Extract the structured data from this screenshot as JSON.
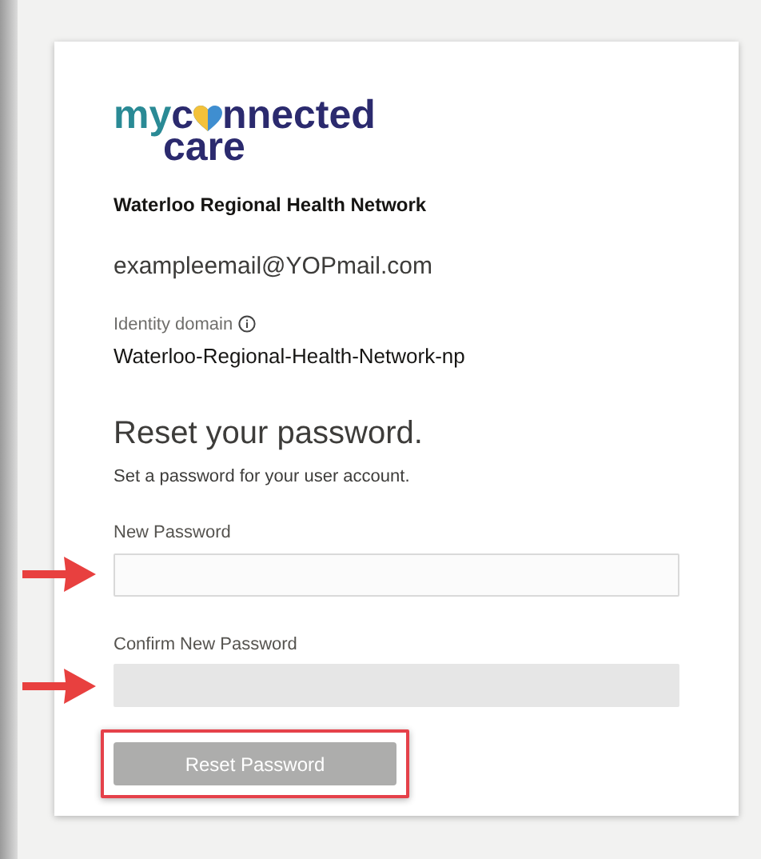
{
  "logo": {
    "prefix": "my",
    "word_start": "c",
    "word_end": "nnected",
    "second_line": "care"
  },
  "organization": "Waterloo Regional Health Network",
  "email": "exampleemail@YOPmail.com",
  "identity_domain": {
    "label": "Identity domain",
    "value": "Waterloo-Regional-Health-Network-np"
  },
  "heading": "Reset your password.",
  "subtitle": "Set a password for your user account.",
  "fields": [
    {
      "label": "New Password",
      "disabled": false,
      "arrow": true
    },
    {
      "label": "Confirm New Password",
      "disabled": true,
      "arrow": true
    }
  ],
  "button": {
    "label": "Reset Password",
    "disabled": true,
    "highlighted": true
  }
}
